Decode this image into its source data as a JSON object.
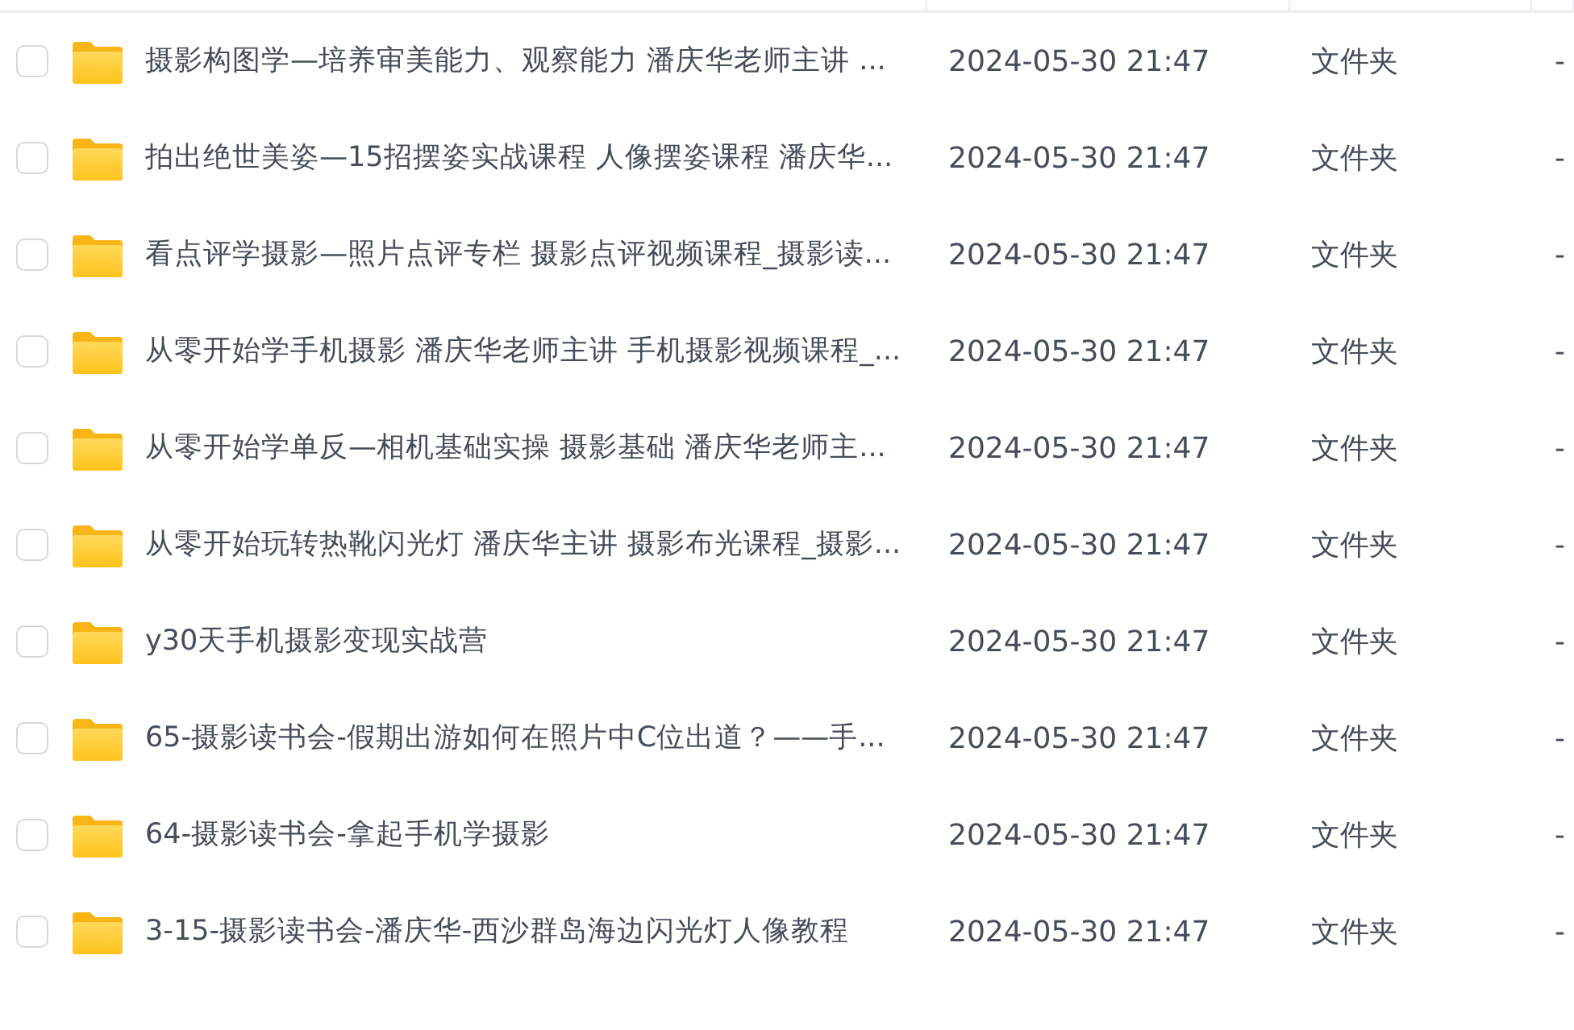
{
  "rows": [
    {
      "checked": false,
      "name": "摄影构图学—培养审美能力、观察能力 潘庆华老师主讲 ...",
      "modified": "2024-05-30 21:47",
      "type": "文件夹",
      "size": "-"
    },
    {
      "checked": false,
      "name": "拍出绝世美姿—15招摆姿实战课程 人像摆姿课程 潘庆华...",
      "modified": "2024-05-30 21:47",
      "type": "文件夹",
      "size": "-"
    },
    {
      "checked": false,
      "name": "看点评学摄影—照片点评专栏  摄影点评视频课程_摄影读...",
      "modified": "2024-05-30 21:47",
      "type": "文件夹",
      "size": "-"
    },
    {
      "checked": false,
      "name": "从零开始学手机摄影 潘庆华老师主讲 手机摄影视频课程_...",
      "modified": "2024-05-30 21:47",
      "type": "文件夹",
      "size": "-"
    },
    {
      "checked": false,
      "name": "从零开始学单反—相机基础实操 摄影基础 潘庆华老师主...",
      "modified": "2024-05-30 21:47",
      "type": "文件夹",
      "size": "-"
    },
    {
      "checked": false,
      "name": "从零开始玩转热靴闪光灯 潘庆华主讲 摄影布光课程_摄影...",
      "modified": "2024-05-30 21:47",
      "type": "文件夹",
      "size": "-"
    },
    {
      "checked": false,
      "name": "y30天手机摄影变现实战营",
      "modified": "2024-05-30 21:47",
      "type": "文件夹",
      "size": "-"
    },
    {
      "checked": false,
      "name": "65-摄影读书会-假期出游如何在照片中C位出道？——手...",
      "modified": "2024-05-30 21:47",
      "type": "文件夹",
      "size": "-"
    },
    {
      "checked": false,
      "name": "64-摄影读书会-拿起手机学摄影",
      "modified": "2024-05-30 21:47",
      "type": "文件夹",
      "size": "-"
    },
    {
      "checked": false,
      "name": "3-15-摄影读书会-潘庆华-西沙群岛海边闪光灯人像教程",
      "modified": "2024-05-30 21:47",
      "type": "文件夹",
      "size": "-"
    }
  ]
}
